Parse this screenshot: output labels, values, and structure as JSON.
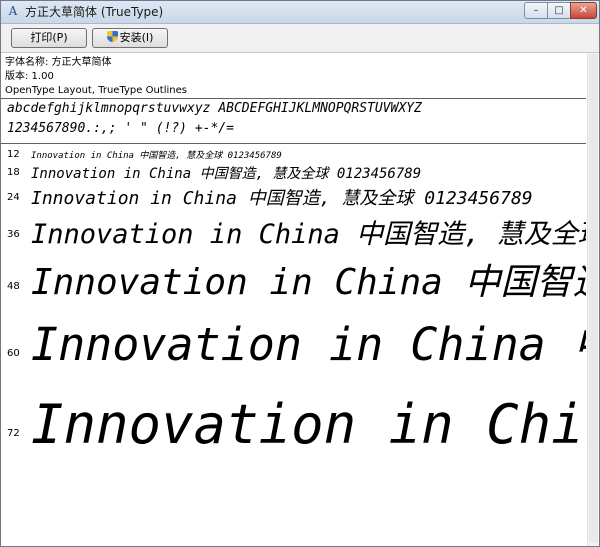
{
  "window": {
    "title": "方正大草简体 (TrueType)",
    "app_icon": "font-viewer-icon"
  },
  "title_controls": {
    "min": "–",
    "max": "□",
    "close": "✕"
  },
  "toolbar": {
    "print_label": "打印(P)",
    "install_label": "安装(I)",
    "install_icon": "uac-shield-icon"
  },
  "font_info": {
    "name_line": "字体名称: 方正大草简体",
    "version_line": "版本: 1.00",
    "type_line": "OpenType Layout, TrueType Outlines"
  },
  "charset": {
    "line1": "abcdefghijklmnopqrstuvwxyz ABCDEFGHIJKLMNOPQRSTUVWXYZ",
    "line2": "1234567890.:,; ' \" (!?) +-*/="
  },
  "samples": {
    "sample_text": "Innovation in China 中国智造, 慧及全球 0123456789",
    "sizes": [
      {
        "size": "12",
        "text": "Innovation in China 中国智造, 慧及全球 0123456789"
      },
      {
        "size": "18",
        "text": "Innovation in China 中国智造, 慧及全球 0123456789"
      },
      {
        "size": "24",
        "text": "Innovation in China 中国智造, 慧及全球 0123456789"
      },
      {
        "size": "36",
        "text": "Innovation in China 中国智造, 慧及全球"
      },
      {
        "size": "48",
        "text": "Innovation in China 中国智造"
      },
      {
        "size": "60",
        "text": "Innovation in China 中国"
      },
      {
        "size": "72",
        "text": "Innovation in China 中"
      }
    ]
  }
}
